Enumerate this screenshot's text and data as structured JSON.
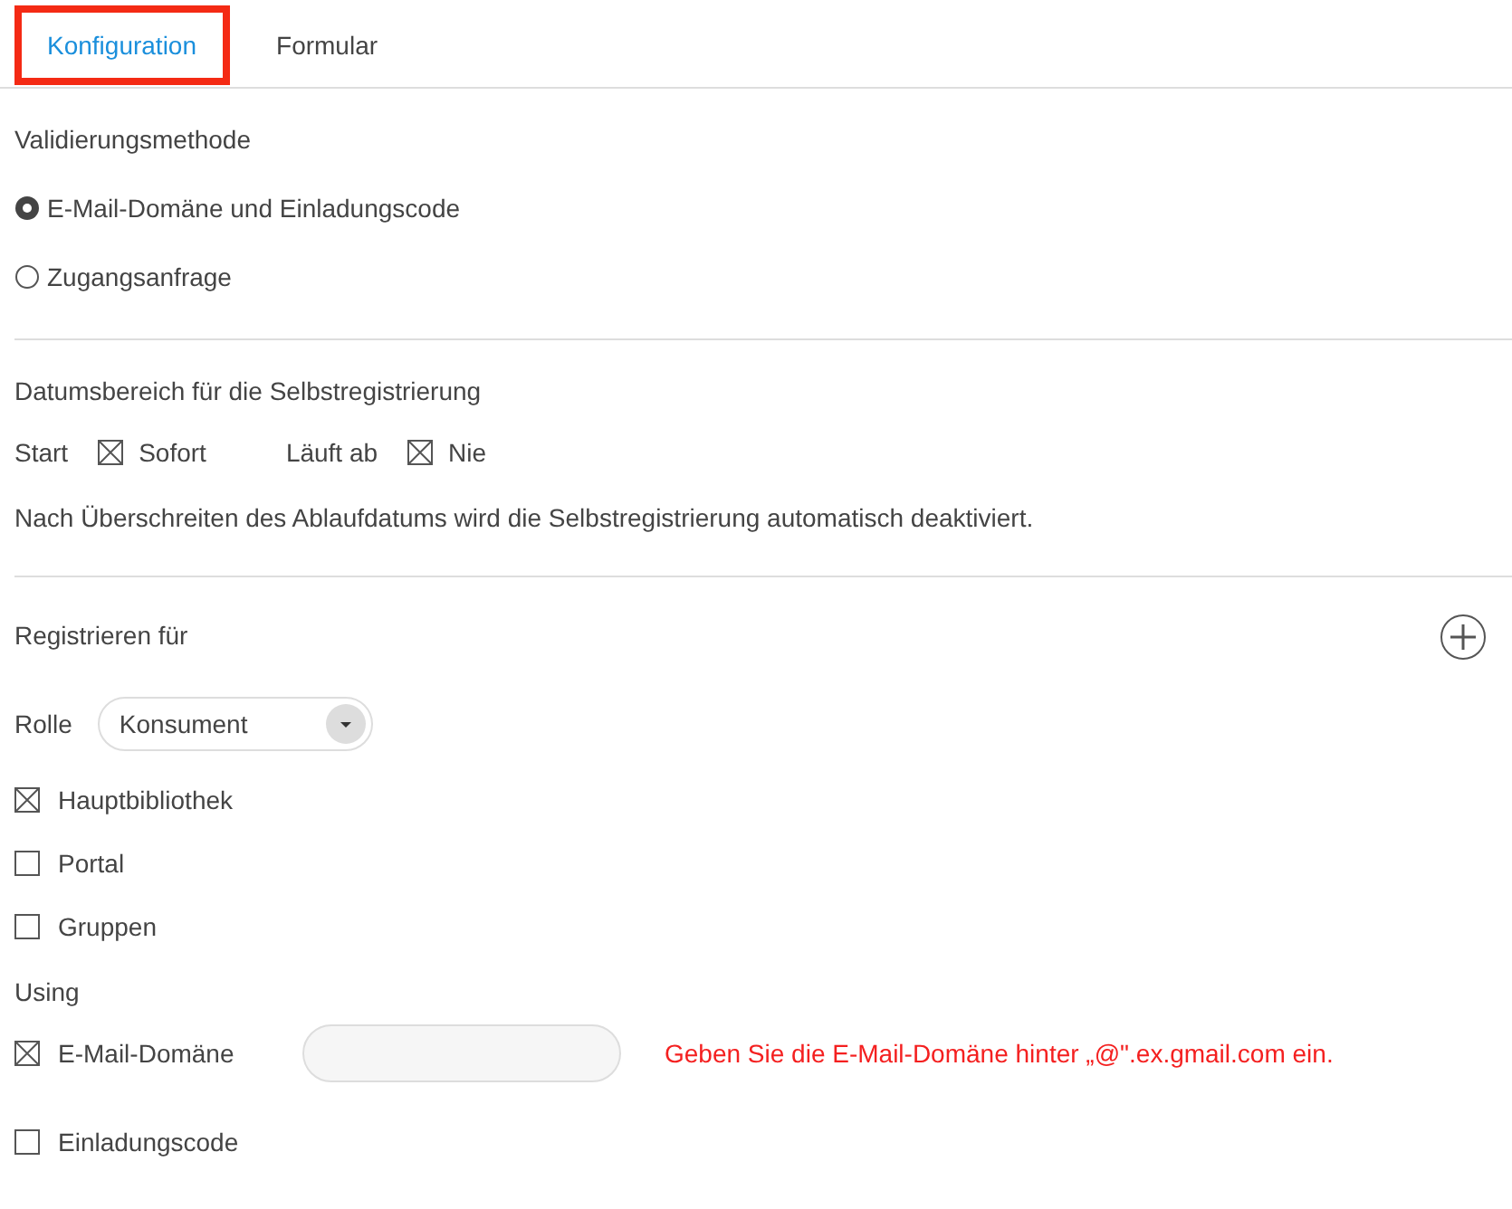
{
  "tabs": [
    {
      "label": "Konfiguration",
      "selected": true,
      "highlighted": true
    },
    {
      "label": "Formular",
      "selected": false,
      "highlighted": false
    }
  ],
  "validation": {
    "heading": "Validierungsmethode",
    "options": [
      {
        "label": "E-Mail-Domäne und Einladungscode",
        "selected": true
      },
      {
        "label": "Zugangsanfrage",
        "selected": false
      }
    ]
  },
  "date_range": {
    "heading": "Datumsbereich für die Selbstregistrierung",
    "start_label": "Start",
    "start_option": {
      "label": "Sofort",
      "checked": true
    },
    "expires_label": "Läuft ab",
    "expires_option": {
      "label": "Nie",
      "checked": true
    },
    "note": "Nach Überschreiten des Ablaufdatums wird die Selbstregistrierung automatisch deaktiviert."
  },
  "register": {
    "heading": "Registrieren für",
    "role_label": "Rolle",
    "role_value": "Konsument",
    "targets": [
      {
        "label": "Hauptbibliothek",
        "checked": true
      },
      {
        "label": "Portal",
        "checked": false
      },
      {
        "label": "Gruppen",
        "checked": false
      }
    ],
    "using_heading": "Using",
    "email_domain": {
      "label": "E-Mail-Domäne",
      "checked": true,
      "error": "Geben Sie die E-Mail-Domäne hinter „@\".ex.gmail.com ein."
    },
    "invite_code": {
      "label": "Einladungscode",
      "checked": false
    }
  }
}
